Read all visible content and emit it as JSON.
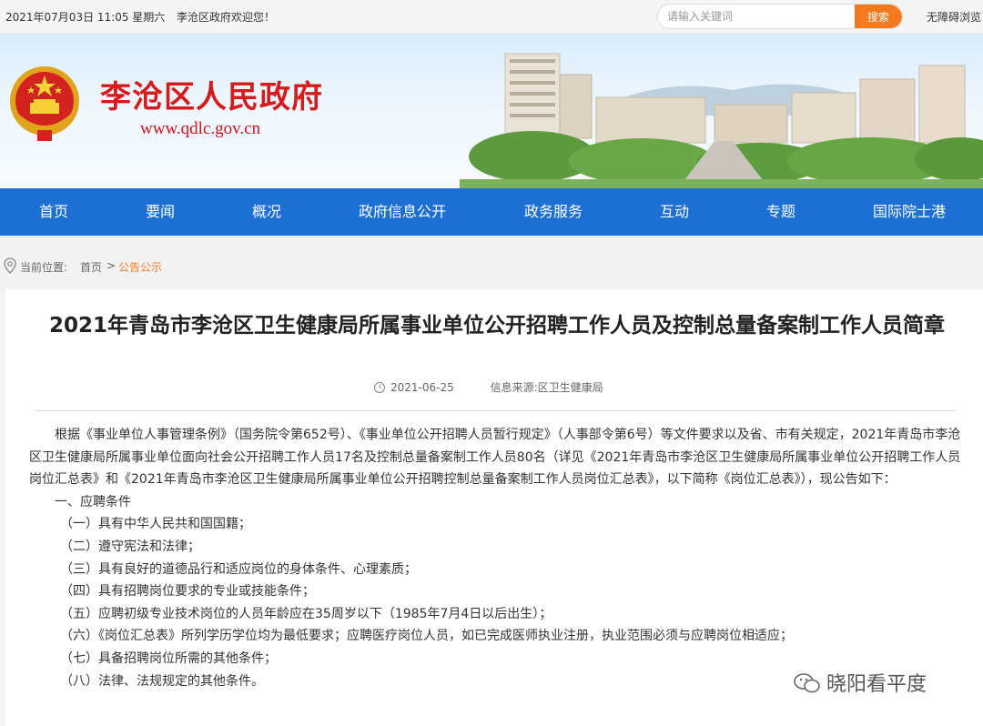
{
  "topbar": {
    "date": "2021年07月03日 11:05 星期六",
    "welcome": "李沧区政府欢迎您！",
    "search_placeholder": "请输入关键词",
    "search_button": "搜索",
    "accessibility": "无障碍浏览"
  },
  "banner": {
    "title": "李沧区人民政府",
    "url": "www.qdlc.gov.cn"
  },
  "nav": {
    "items": [
      {
        "label": "首页"
      },
      {
        "label": "要闻"
      },
      {
        "label": "概况"
      },
      {
        "label": "政府信息公开"
      },
      {
        "label": "政务服务"
      },
      {
        "label": "互动"
      },
      {
        "label": "专题"
      },
      {
        "label": "国际院士港"
      }
    ]
  },
  "breadcrumb": {
    "label": "当前位置:",
    "home": "首页",
    "separator": ">",
    "current": "公告公示"
  },
  "article": {
    "title": "2021年青岛市李沧区卫生健康局所属事业单位公开招聘工作人员及控制总量备案制工作人员简章",
    "date": "2021-06-25",
    "source_label": "信息来源:",
    "source": "区卫生健康局",
    "intro": "根据《事业单位人事管理条例》（国务院令第652号）、《事业单位公开招聘人员暂行规定》（人事部令第6号）等文件要求以及省、市有关规定，2021年青岛市李沧区卫生健康局所属事业单位面向社会公开招聘工作人员17名及控制总量备案制工作人员80名（详见《2021年青岛市李沧区卫生健康局所属事业单位公开招聘工作人员岗位汇总表》和《2021年青岛市李沧区卫生健康局所属事业单位公开招聘控制总量备案制工作人员岗位汇总表》，以下简称《岗位汇总表》），现公告如下：",
    "section1": "一、应聘条件",
    "items": [
      "（一）具有中华人民共和国国籍；",
      "（二）遵守宪法和法律；",
      "（三）具有良好的道德品行和适应岗位的身体条件、心理素质；",
      "（四）具有招聘岗位要求的专业或技能条件；",
      "（五）应聘初级专业技术岗位的人员年龄应在35周岁以下（1985年7月4日以后出生）；",
      "（六）《岗位汇总表》所列学历学位均为最低要求；应聘医疗岗位人员，如已完成医师执业注册，执业范围必须与应聘岗位相适应；",
      "（七）具备招聘岗位所需的其他条件；",
      "（八）法律、法规规定的其他条件。"
    ]
  },
  "watermark": "晓阳看平度",
  "colors": {
    "nav_bg": "#1d6fd4",
    "accent_orange": "#f4791f",
    "title_red": "#d41c1c"
  }
}
